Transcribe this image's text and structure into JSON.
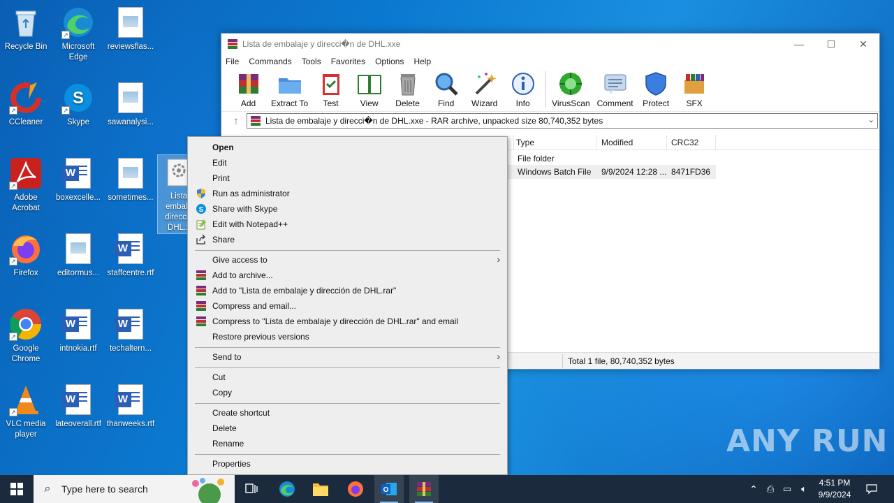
{
  "desktop": {
    "icons": [
      {
        "label": "Recycle Bin"
      },
      {
        "label": "Microsoft Edge"
      },
      {
        "label": "reviewsflas..."
      },
      {
        "label": "CCleaner"
      },
      {
        "label": "Skype"
      },
      {
        "label": "sawanalysi..."
      },
      {
        "label": "Adobe Acrobat"
      },
      {
        "label": "boxexcelle..."
      },
      {
        "label": "sometimes..."
      },
      {
        "label": "Lista de embalaje y dirección de DHL.xxe"
      },
      {
        "label": "Firefox"
      },
      {
        "label": "editormus..."
      },
      {
        "label": "staffcentre.rtf"
      },
      {
        "label": "Google Chrome"
      },
      {
        "label": "intnokia.rtf"
      },
      {
        "label": "techaltern..."
      },
      {
        "label": "VLC media player"
      },
      {
        "label": "lateoverall.rtf"
      },
      {
        "label": "thanweeks.rtf"
      }
    ],
    "selected_icon_visible": "Lista\nembala\ndirecció\nDHL.x"
  },
  "winrar": {
    "title": "Lista de embalaje y direcci�n de DHL.xxe",
    "menu": [
      "File",
      "Commands",
      "Tools",
      "Favorites",
      "Options",
      "Help"
    ],
    "toolbar": [
      "Add",
      "Extract To",
      "Test",
      "View",
      "Delete",
      "Find",
      "Wizard",
      "Info",
      "VirusScan",
      "Comment",
      "Protect",
      "SFX"
    ],
    "address": "Lista de embalaje y direcci�n de DHL.xxe - RAR archive, unpacked size 80,740,352 bytes",
    "columns": [
      "Type",
      "Modified",
      "CRC32"
    ],
    "rows": [
      {
        "type": "File folder",
        "modified": "",
        "crc": ""
      },
      {
        "type": "Windows Batch File",
        "modified": "9/9/2024 12:28 ...",
        "crc": "8471FD36"
      }
    ],
    "status": "Total 1 file, 80,740,352 bytes"
  },
  "context_menu": {
    "items": [
      {
        "label": "Open",
        "bold": true
      },
      {
        "label": "Edit"
      },
      {
        "label": "Print"
      },
      {
        "label": "Run as administrator",
        "icon": "shield-icon"
      },
      {
        "label": "Share with Skype",
        "icon": "skype-icon"
      },
      {
        "label": "Edit with Notepad++",
        "icon": "notepadpp-icon"
      },
      {
        "label": "Share",
        "icon": "share-icon"
      },
      {
        "label": "Give access to",
        "submenu": true
      },
      {
        "label": "Add to archive...",
        "icon": "winrar-icon"
      },
      {
        "label": "Add to \"Lista de embalaje y dirección de DHL.rar\"",
        "icon": "winrar-icon"
      },
      {
        "label": "Compress and email...",
        "icon": "winrar-icon"
      },
      {
        "label": "Compress to \"Lista de embalaje y dirección de DHL.rar\" and email",
        "icon": "winrar-icon"
      },
      {
        "label": "Restore previous versions"
      },
      {
        "label": "Send to",
        "submenu": true
      },
      {
        "label": "Cut"
      },
      {
        "label": "Copy"
      },
      {
        "label": "Create shortcut"
      },
      {
        "label": "Delete"
      },
      {
        "label": "Rename"
      },
      {
        "label": "Properties"
      }
    ]
  },
  "taskbar": {
    "search_placeholder": "Type here to search",
    "time": "4:51 PM",
    "date": "9/9/2024"
  },
  "watermark": "ANY RUN"
}
